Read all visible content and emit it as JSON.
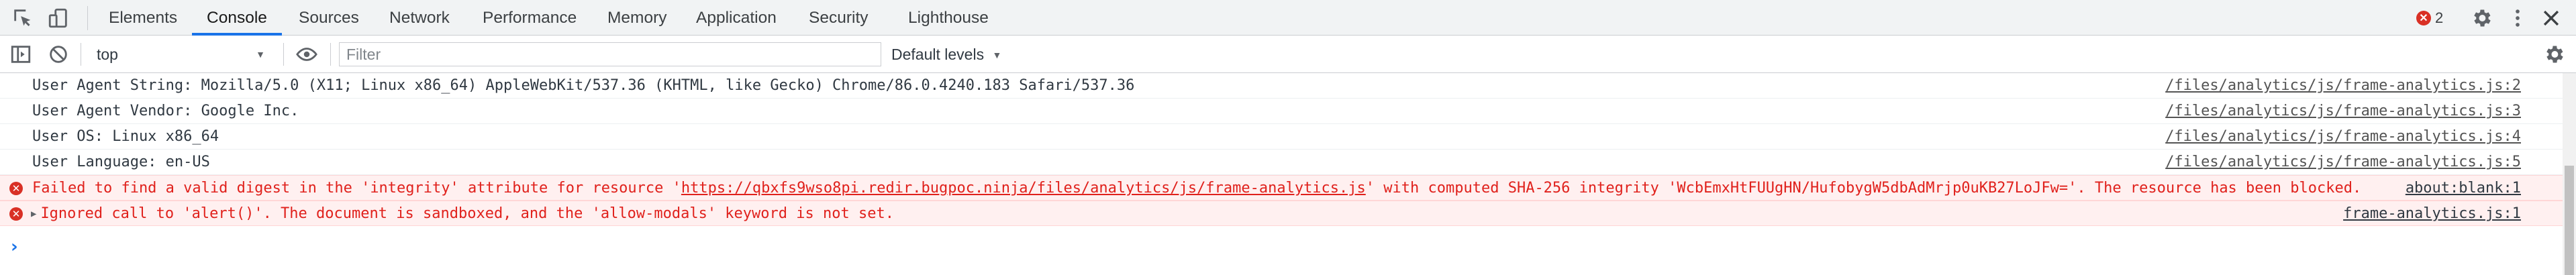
{
  "tabs": [
    {
      "label": "Elements"
    },
    {
      "label": "Console"
    },
    {
      "label": "Sources"
    },
    {
      "label": "Network"
    },
    {
      "label": "Performance"
    },
    {
      "label": "Memory"
    },
    {
      "label": "Application"
    },
    {
      "label": "Security"
    },
    {
      "label": "Lighthouse"
    }
  ],
  "active_tab": "Console",
  "error_count": "2",
  "toolbar": {
    "context": "top",
    "filter_placeholder": "Filter",
    "levels": "Default levels"
  },
  "messages": [
    {
      "text": "User Agent String: Mozilla/5.0 (X11; Linux x86_64) AppleWebKit/537.36 (KHTML, like Gecko) Chrome/86.0.4240.183 Safari/537.36",
      "source": "/files/analytics/js/frame-analytics.js:2"
    },
    {
      "text": "User Agent Vendor: Google Inc.",
      "source": "/files/analytics/js/frame-analytics.js:3"
    },
    {
      "text": "User OS: Linux x86_64",
      "source": "/files/analytics/js/frame-analytics.js:4"
    },
    {
      "text": "User Language: en-US",
      "source": "/files/analytics/js/frame-analytics.js:5"
    }
  ],
  "errors": [
    {
      "text_before": "Failed to find a valid digest in the 'integrity' attribute for resource '",
      "link": "https://qbxfs9wso8pi.redir.bugpoc.ninja/files/analytics/js/frame-analytics.js",
      "text_after": "' with computed SHA-256 integrity 'WcbEmxHtFUUgHN/HufobygW5dbAdMrjp0uKB27LoJFw='. The resource has been blocked.",
      "source": "about:blank:1"
    },
    {
      "text": "Ignored call to 'alert()'. The document is sandboxed, and the 'allow-modals' keyword is not set.",
      "source": "frame-analytics.js:1"
    }
  ],
  "prompt": "›",
  "colors": {
    "accent": "#1a73e8",
    "error": "#d93025",
    "error_bg": "#fff0f0"
  }
}
